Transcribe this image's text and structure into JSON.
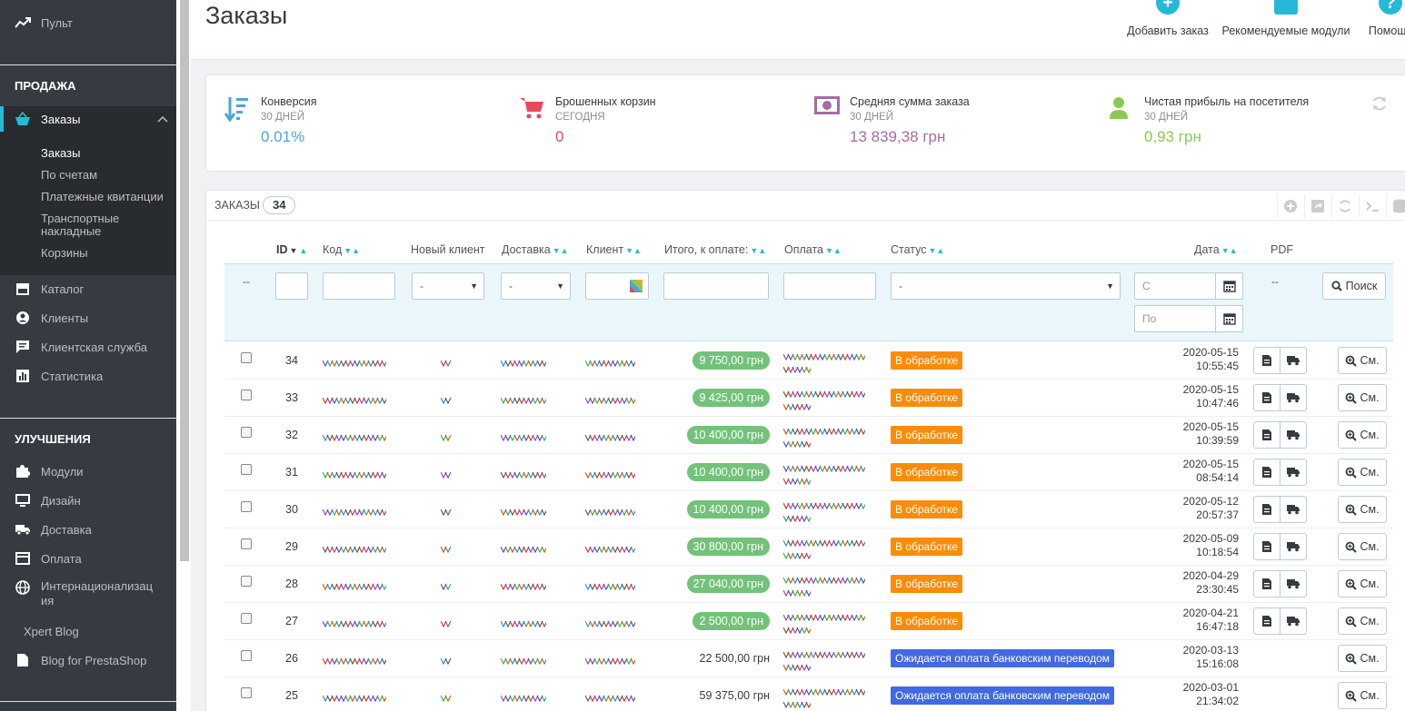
{
  "sidebar": {
    "dashboard": "Пульт",
    "section_sell": "ПРОДАЖА",
    "orders": "Заказы",
    "orders_sub": [
      "Заказы",
      "По счетам",
      "Платежные квитанции",
      "Транспортные накладные",
      "Корзины"
    ],
    "catalog": "Каталог",
    "customers": "Клиенты",
    "customer_service": "Клиентская служба",
    "stats": "Статистика",
    "section_improve": "УЛУЧШЕНИЯ",
    "modules": "Модули",
    "design": "Дизайн",
    "shipping": "Доставка",
    "payment": "Оплата",
    "international": "Интернационализация",
    "xpert_blog": "Xpert Blog",
    "blog_prestashop": "Blog for PrestaShop",
    "accent": "#25b9d7"
  },
  "header": {
    "title": "Заказы",
    "add_order": "Добавить заказ",
    "recommended_modules": "Рекомендуемые модули",
    "help": "Помощь"
  },
  "kpis": [
    {
      "title": "Конверсия",
      "period": "30 ДНЕЙ",
      "value": "0.01%",
      "color": "#4fa3db",
      "icon": "sort-down-icon"
    },
    {
      "title": "Брошенных корзин",
      "period": "СЕГОДНЯ",
      "value": "0",
      "color": "#e54a5a",
      "icon": "cart-icon"
    },
    {
      "title": "Средняя сумма заказа",
      "period": "30 ДНЕЙ",
      "value": "13 839,38 грн",
      "color": "#a56da2",
      "icon": "money-icon"
    },
    {
      "title": "Чистая прибыль на посетителя",
      "period": "30 ДНЕЙ",
      "value": "0,93 грн",
      "color": "#8bc954",
      "icon": "user-icon"
    }
  ],
  "orders_panel": {
    "title": "ЗАКАЗЫ",
    "count": "34",
    "columns": {
      "id": "ID",
      "code": "Код",
      "new_client": "Новый клиент",
      "delivery": "Доставка",
      "client": "Клиент",
      "total": "Итого, к оплате:",
      "payment": "Оплата",
      "status": "Статус",
      "date": "Дата",
      "pdf": "PDF"
    },
    "filters": {
      "dash": "--",
      "new_client": "-",
      "delivery": "-",
      "status": "-",
      "date_from": "С",
      "date_to": "По",
      "pdf_dash": "--",
      "search": "Поиск"
    },
    "view_label": "См.",
    "rows": [
      {
        "id": "34",
        "total": "9 750,00 грн",
        "badge": true,
        "status": "В обработке",
        "status_color": "#fb8c0a",
        "date": "2020-05-15",
        "time": "10:55:45",
        "pdf": true
      },
      {
        "id": "33",
        "total": "9 425,00 грн",
        "badge": true,
        "status": "В обработке",
        "status_color": "#fb8c0a",
        "date": "2020-05-15",
        "time": "10:47:46",
        "pdf": true
      },
      {
        "id": "32",
        "total": "10 400,00 грн",
        "badge": true,
        "status": "В обработке",
        "status_color": "#fb8c0a",
        "date": "2020-05-15",
        "time": "10:39:59",
        "pdf": true
      },
      {
        "id": "31",
        "total": "10 400,00 грн",
        "badge": true,
        "status": "В обработке",
        "status_color": "#fb8c0a",
        "date": "2020-05-15",
        "time": "08:54:14",
        "pdf": true
      },
      {
        "id": "30",
        "total": "10 400,00 грн",
        "badge": true,
        "status": "В обработке",
        "status_color": "#fb8c0a",
        "date": "2020-05-12",
        "time": "20:57:37",
        "pdf": true
      },
      {
        "id": "29",
        "total": "30 800,00 грн",
        "badge": true,
        "status": "В обработке",
        "status_color": "#fb8c0a",
        "date": "2020-05-09",
        "time": "10:18:54",
        "pdf": true
      },
      {
        "id": "28",
        "total": "27 040,00 грн",
        "badge": true,
        "status": "В обработке",
        "status_color": "#fb8c0a",
        "date": "2020-04-29",
        "time": "23:30:45",
        "pdf": true
      },
      {
        "id": "27",
        "total": "2 500,00 грн",
        "badge": true,
        "status": "В обработке",
        "status_color": "#fb8c0a",
        "date": "2020-04-21",
        "time": "16:47:18",
        "pdf": true
      },
      {
        "id": "26",
        "total": "22 500,00 грн",
        "badge": false,
        "status": "Ожидается оплата банковским переводом",
        "status_color": "#4169e1",
        "date": "2020-03-13",
        "time": "15:16:08",
        "pdf": false
      },
      {
        "id": "25",
        "total": "59 375,00 грн",
        "badge": false,
        "status": "Ожидается оплата банковским переводом",
        "status_color": "#4169e1",
        "date": "2020-03-01",
        "time": "21:34:02",
        "pdf": false
      }
    ]
  }
}
